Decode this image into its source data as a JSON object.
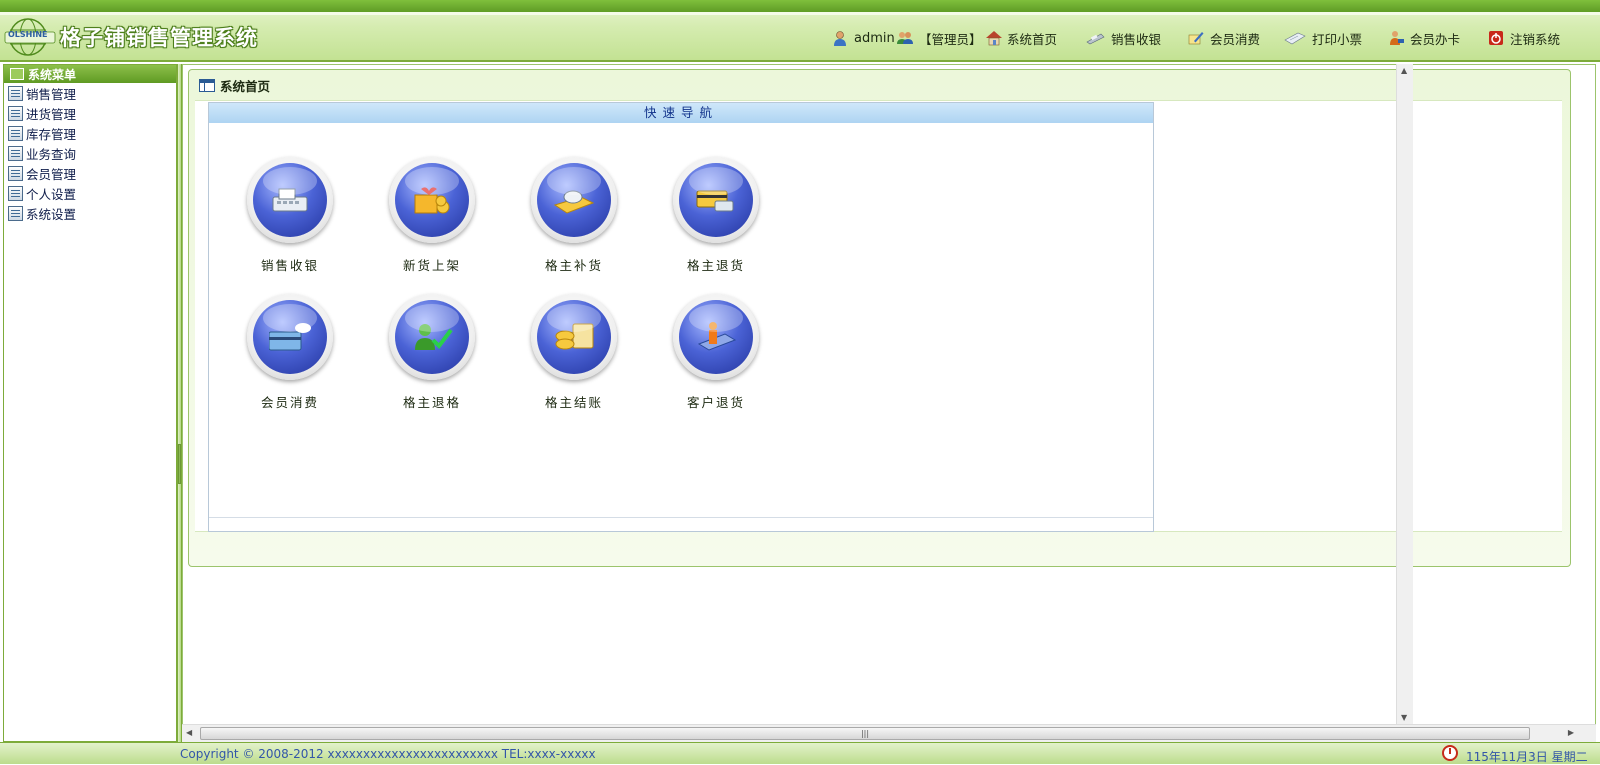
{
  "header": {
    "logo_text": "OLSHINE",
    "app_title": "格子铺销售管理系统",
    "user": "admin",
    "role": "【管理员】",
    "nav": [
      {
        "label": "系统首页",
        "icon": "house-icon"
      },
      {
        "label": "销售收银",
        "icon": "cash-register-icon"
      },
      {
        "label": "会员消费",
        "icon": "pen-card-icon"
      },
      {
        "label": "打印小票",
        "icon": "receipt-icon"
      },
      {
        "label": "会员办卡",
        "icon": "member-card-icon"
      },
      {
        "label": "注销系统",
        "icon": "power-icon"
      }
    ]
  },
  "sidebar": {
    "title": "系统菜单",
    "items": [
      {
        "label": "销售管理"
      },
      {
        "label": "进货管理"
      },
      {
        "label": "库存管理"
      },
      {
        "label": "业务查询"
      },
      {
        "label": "会员管理"
      },
      {
        "label": "个人设置"
      },
      {
        "label": "系统设置"
      }
    ]
  },
  "main": {
    "panel_title": "系统首页",
    "quick_nav": {
      "title": "快速导航",
      "tiles": [
        {
          "label": "销售收银",
          "icon": "cash-register-icon"
        },
        {
          "label": "新货上架",
          "icon": "gift-box-icon"
        },
        {
          "label": "格主补货",
          "icon": "mouse-card-icon"
        },
        {
          "label": "格主退货",
          "icon": "card-key-icon"
        },
        {
          "label": "会员消费",
          "icon": "new-card-icon"
        },
        {
          "label": "格主退格",
          "icon": "user-check-icon"
        },
        {
          "label": "格主结账",
          "icon": "coins-icon"
        },
        {
          "label": "客户退货",
          "icon": "person-book-icon"
        }
      ]
    }
  },
  "footer": {
    "copyright": "Copyright © 2008-2012 xxxxxxxxxxxxxxxxxxxxxxxx TEL:xxxx-xxxxx",
    "date": "115年11月3日 星期二"
  },
  "colors": {
    "accent_green": "#7dab3a",
    "quick_nav_header": "#aed4f2",
    "tile_blue": "#4b63d6",
    "footer_text": "#3356a8"
  }
}
